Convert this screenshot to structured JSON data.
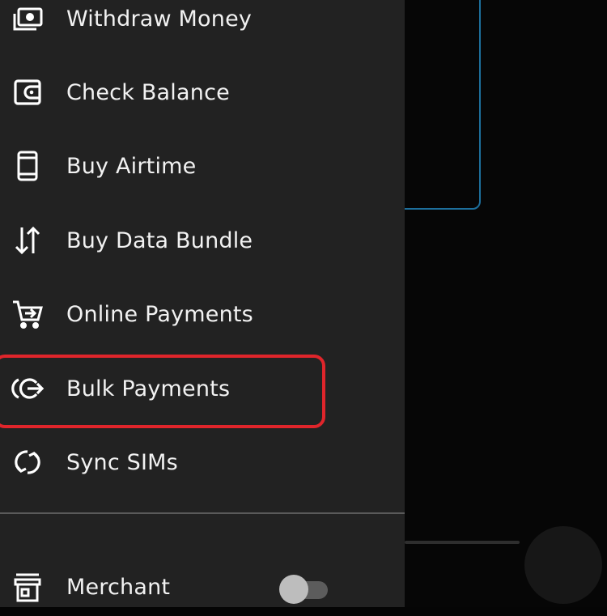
{
  "drawer": {
    "items": [
      {
        "label": "Withdraw Money",
        "icon": "withdraw-money-icon"
      },
      {
        "label": "Check Balance",
        "icon": "wallet-icon"
      },
      {
        "label": "Buy Airtime",
        "icon": "phone-icon"
      },
      {
        "label": "Buy Data Bundle",
        "icon": "up-down-arrows-icon"
      },
      {
        "label": "Online Payments",
        "icon": "cart-icon"
      },
      {
        "label": "Bulk Payments",
        "icon": "bulk-payments-icon"
      },
      {
        "label": "Sync SIMs",
        "icon": "sync-icon"
      }
    ],
    "merchant": {
      "label": "Merchant",
      "icon": "store-icon",
      "toggle_on": false
    }
  },
  "colors": {
    "drawer_bg": "#222222",
    "highlight": "#e0252b",
    "text": "#f2f2f2",
    "background_card_border": "#1d6f9c"
  }
}
